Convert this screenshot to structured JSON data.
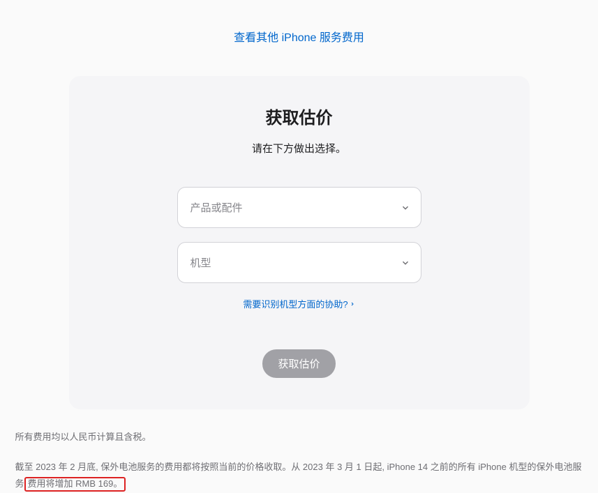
{
  "topLink": "查看其他 iPhone 服务费用",
  "card": {
    "title": "获取估价",
    "subtitle": "请在下方做出选择。",
    "productPlaceholder": "产品或配件",
    "modelPlaceholder": "机型",
    "helpLink": "需要识别机型方面的协助?",
    "estimateBtn": "获取估价"
  },
  "footer": {
    "line1": "所有费用均以人民币计算且含税。",
    "para_part1": "截至 2023 年 2 月底, 保外电池服务的费用都将按照当前的价格收取。从 2023 年 3 月 1 日起, iPhone 14 之前的所有 iPhone 机型的保外电池服务",
    "para_highlight": "费用将增加 RMB 169。"
  }
}
